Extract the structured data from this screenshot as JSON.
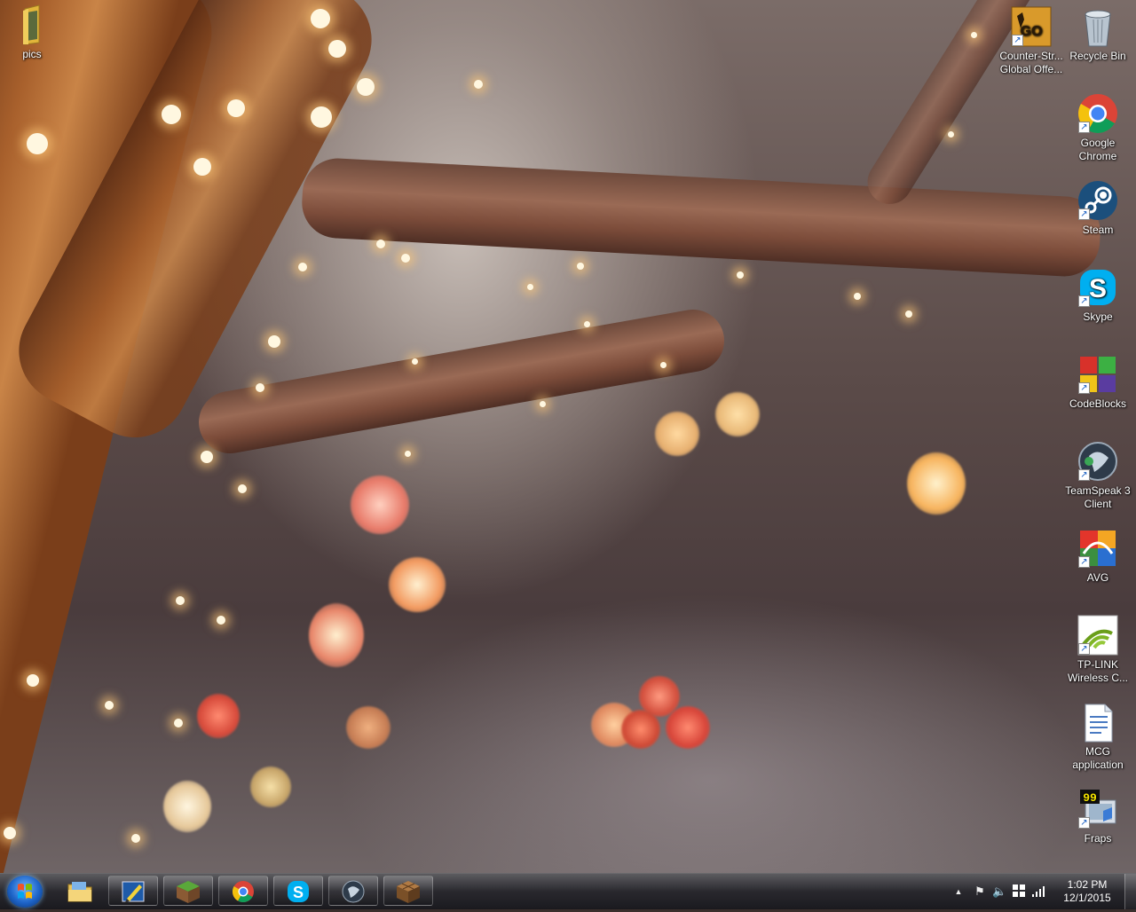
{
  "desktop": {
    "left_icons": [
      {
        "label": "pics",
        "icon": "folder-icon"
      }
    ],
    "right_icons": [
      {
        "label": "Counter-Str... Global Offe...",
        "icon": "csgo-icon"
      },
      {
        "label": "Recycle Bin",
        "icon": "recycle-bin-icon"
      },
      {
        "label": "Google Chrome",
        "icon": "chrome-icon"
      },
      {
        "label": "Steam",
        "icon": "steam-icon"
      },
      {
        "label": "Skype",
        "icon": "skype-icon"
      },
      {
        "label": "CodeBlocks",
        "icon": "codeblocks-icon"
      },
      {
        "label": "TeamSpeak 3 Client",
        "icon": "teamspeak-icon"
      },
      {
        "label": "AVG",
        "icon": "avg-icon"
      },
      {
        "label": "TP-LINK Wireless C...",
        "icon": "tplink-wireless-icon"
      },
      {
        "label": "MCG application",
        "icon": "document-icon"
      },
      {
        "label": "Fraps",
        "icon": "fraps-icon"
      }
    ]
  },
  "taskbar": {
    "pinned": [
      {
        "name": "explorer",
        "icon": "folder-icon"
      },
      {
        "name": "editor",
        "icon": "pen-icon"
      },
      {
        "name": "minecraft",
        "icon": "grass-block-icon"
      },
      {
        "name": "chrome",
        "icon": "chrome-icon"
      },
      {
        "name": "skype",
        "icon": "skype-icon"
      },
      {
        "name": "teamspeak",
        "icon": "teamspeak-icon"
      },
      {
        "name": "crafting",
        "icon": "crafting-table-icon"
      }
    ],
    "tray": {
      "time": "1:02 PM",
      "date": "12/1/2015"
    }
  },
  "colors": {
    "chrome_red": "#db4437",
    "chrome_yellow": "#f4c20d",
    "chrome_green": "#0f9d58",
    "chrome_blue": "#4285f4",
    "skype_blue": "#00aff0",
    "steam_blue": "#1b4f7c"
  }
}
